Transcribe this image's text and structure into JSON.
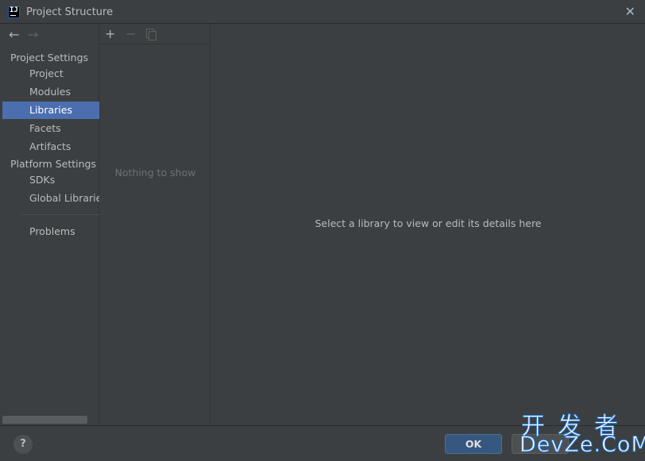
{
  "window": {
    "title": "Project Structure",
    "close_glyph": "✕"
  },
  "sidebar": {
    "back_glyph": "←",
    "forward_glyph": "→",
    "project_settings_header": "Project Settings",
    "project_items": [
      {
        "label": "Project",
        "selected": false
      },
      {
        "label": "Modules",
        "selected": false
      },
      {
        "label": "Libraries",
        "selected": true
      },
      {
        "label": "Facets",
        "selected": false
      },
      {
        "label": "Artifacts",
        "selected": false
      }
    ],
    "platform_settings_header": "Platform Settings",
    "platform_items": [
      {
        "label": "SDKs",
        "selected": false
      },
      {
        "label": "Global Libraries",
        "selected": false
      }
    ],
    "problems_label": "Problems"
  },
  "list_pane": {
    "add_glyph": "+",
    "remove_glyph": "−",
    "empty_text": "Nothing to show"
  },
  "details": {
    "hint": "Select a library to view or edit its details here"
  },
  "footer": {
    "help_glyph": "?",
    "ok_label": "OK"
  },
  "watermark": {
    "cn": "开发者",
    "en": "DevZe.CoM"
  },
  "colors": {
    "background": "#3c3f41",
    "selection": "#4b6eaf",
    "ok_button": "#365880"
  },
  "icons": [
    "app-icon",
    "back-arrow-icon",
    "forward-arrow-icon",
    "add-icon",
    "remove-icon",
    "copy-icon",
    "close-icon",
    "help-icon"
  ]
}
